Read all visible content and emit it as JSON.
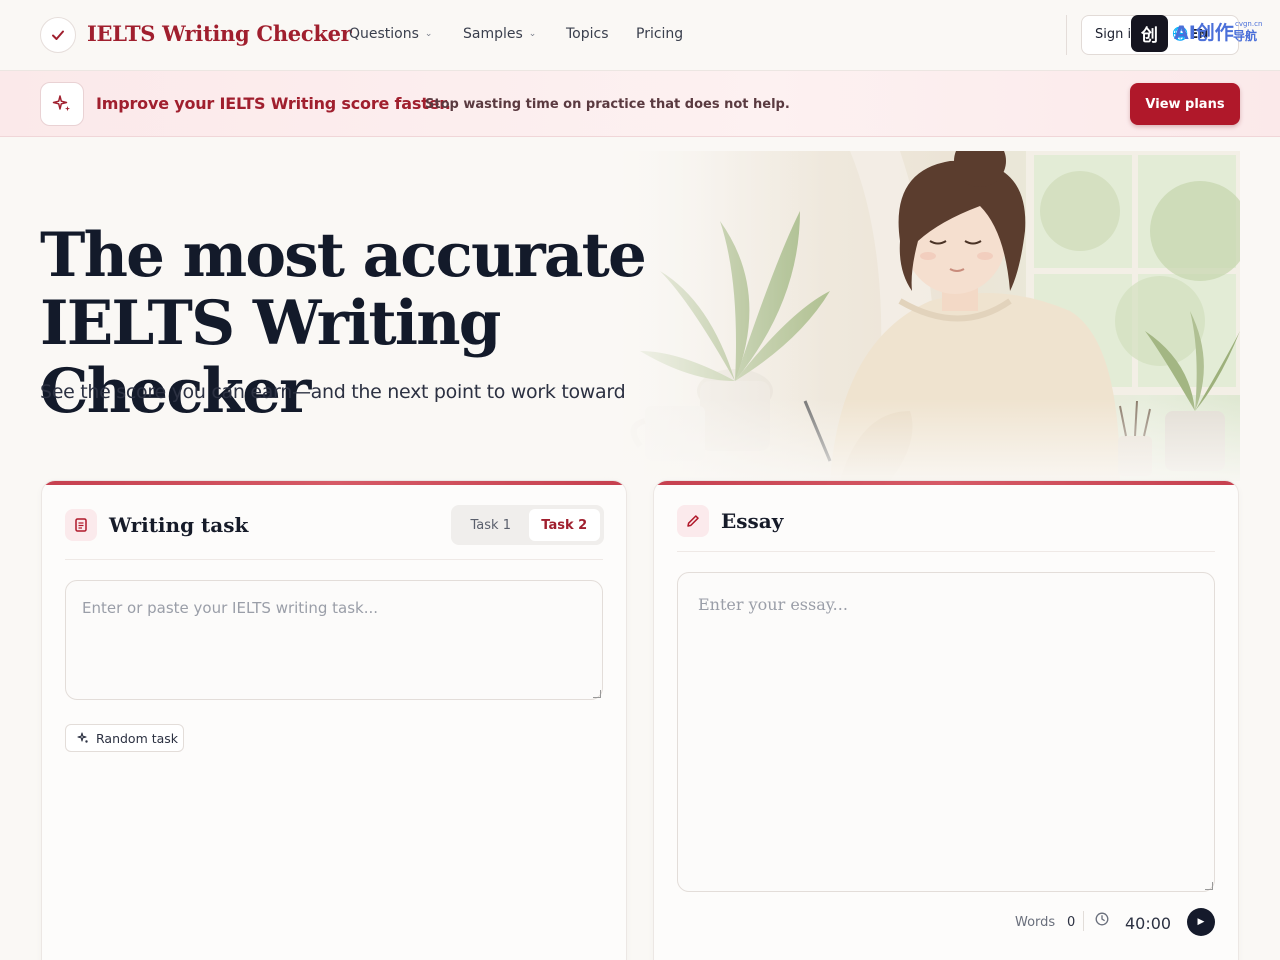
{
  "header": {
    "logo_text": "IELTS Writing Checker",
    "nav": [
      {
        "label": "Questions",
        "has_dropdown": true
      },
      {
        "label": "Samples",
        "has_dropdown": true
      },
      {
        "label": "Topics",
        "has_dropdown": false
      },
      {
        "label": "Pricing",
        "has_dropdown": false
      }
    ],
    "sign_in_label": "Sign in",
    "language_label": "EN"
  },
  "watermark": {
    "text": "AI创作",
    "sub": "导航",
    "tiny": "cvgn.cn"
  },
  "promo": {
    "title": "Improve your IELTS Writing score faster.",
    "subtitle": "Stop wasting time on practice that does not help.",
    "cta_label": "View plans"
  },
  "hero": {
    "title_line1": "The most accurate",
    "title_line2": "IELTS Writing Checker",
    "subtitle": "See the score you can earn—and the next point to work toward"
  },
  "writing_task": {
    "title": "Writing task",
    "tabs": [
      {
        "label": "Task 1",
        "active": false
      },
      {
        "label": "Task 2",
        "active": true
      }
    ],
    "placeholder": "Enter or paste your IELTS writing task...",
    "random_label": "Random task"
  },
  "essay": {
    "title": "Essay",
    "placeholder": "Enter your essay...",
    "words_label": "Words",
    "words_value": "0",
    "timer": "40:00"
  },
  "colors": {
    "brand": "#a01f2e",
    "cta": "#b0182a",
    "heading": "#131a2a",
    "background": "#faf8f5"
  }
}
